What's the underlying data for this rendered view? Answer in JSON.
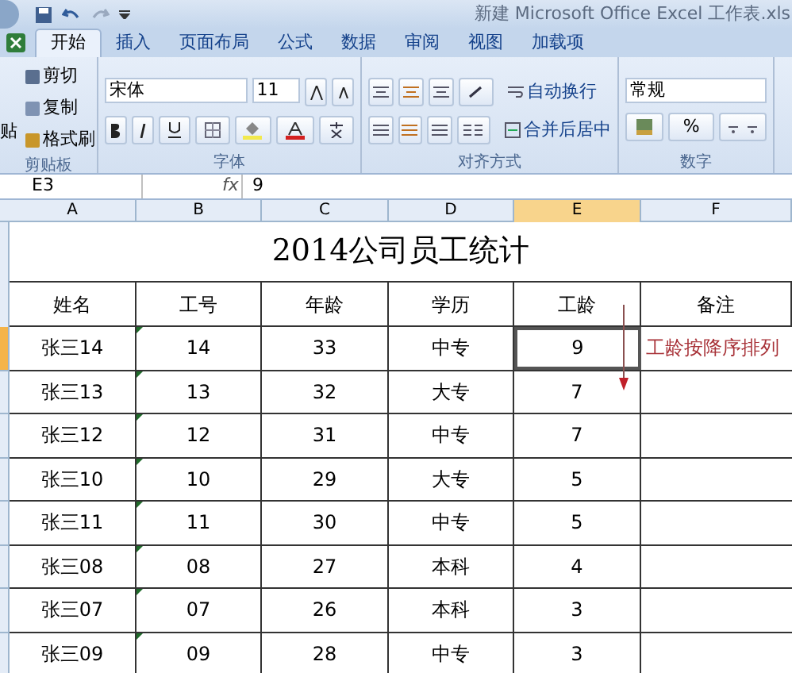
{
  "window": {
    "title": "新建 Microsoft Office Excel 工作表.xls"
  },
  "tabs": [
    {
      "label": "开始",
      "selected": true
    },
    {
      "label": "插入",
      "selected": false
    },
    {
      "label": "页面布局",
      "selected": false
    },
    {
      "label": "公式",
      "selected": false
    },
    {
      "label": "数据",
      "selected": false
    },
    {
      "label": "审阅",
      "selected": false
    },
    {
      "label": "视图",
      "selected": false
    },
    {
      "label": "加载项",
      "selected": false
    }
  ],
  "ribbon": {
    "clipboard": {
      "label": "剪贴板",
      "paste": "贴",
      "items": [
        "剪切",
        "复制",
        "格式刷"
      ]
    },
    "font": {
      "label": "字体",
      "font_name": "宋体",
      "font_size": "11"
    },
    "alignment": {
      "label": "对齐方式",
      "wrap_text": "自动换行",
      "merge_center": "合并后居中"
    },
    "number": {
      "label": "数字",
      "format": "常规",
      "percent": "%"
    }
  },
  "formula_bar": {
    "cell": "E3",
    "fx": "fx",
    "value": "9"
  },
  "columns": [
    {
      "label": "A",
      "selected": false
    },
    {
      "label": "B",
      "selected": false
    },
    {
      "label": "C",
      "selected": false
    },
    {
      "label": "D",
      "selected": false
    },
    {
      "label": "E",
      "selected": true
    },
    {
      "label": "F",
      "selected": false
    }
  ],
  "sheet": {
    "title": "2014公司员工统计",
    "headers": [
      "姓名",
      "工号",
      "年龄",
      "学历",
      "工龄",
      "备注"
    ],
    "rows": [
      {
        "selected": true,
        "cells": [
          "张三14",
          "14",
          "33",
          "中专",
          "9"
        ],
        "note": "工龄按降序排列"
      },
      {
        "selected": false,
        "cells": [
          "张三13",
          "13",
          "32",
          "大专",
          "7"
        ]
      },
      {
        "selected": false,
        "cells": [
          "张三12",
          "12",
          "31",
          "中专",
          "7"
        ]
      },
      {
        "selected": false,
        "cells": [
          "张三10",
          "10",
          "29",
          "大专",
          "5"
        ]
      },
      {
        "selected": false,
        "cells": [
          "张三11",
          "11",
          "30",
          "中专",
          "5"
        ]
      },
      {
        "selected": false,
        "cells": [
          "张三08",
          "08",
          "27",
          "本科",
          "4"
        ]
      },
      {
        "selected": false,
        "cells": [
          "张三07",
          "07",
          "26",
          "本科",
          "3"
        ]
      },
      {
        "selected": false,
        "cells": [
          "张三09",
          "09",
          "28",
          "中专",
          "3"
        ]
      }
    ]
  }
}
